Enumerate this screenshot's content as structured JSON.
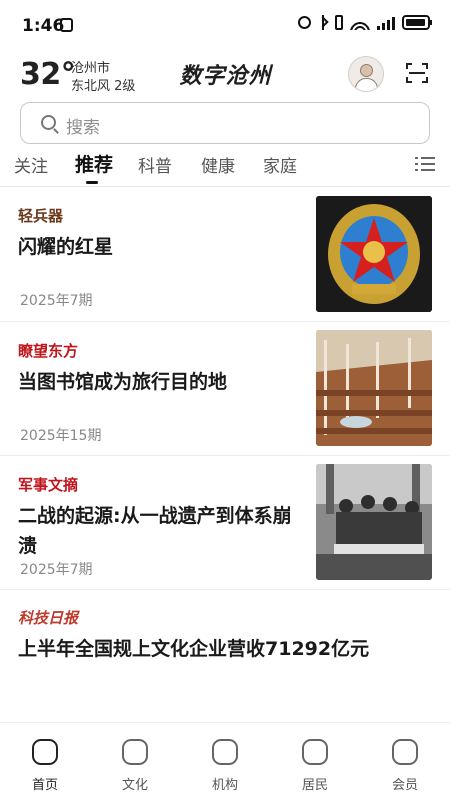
{
  "status_bar": {
    "time": "1:46"
  },
  "header": {
    "temperature": "32°",
    "city": "沧州市",
    "wind": "东北风  2级",
    "brand": "数字沧州"
  },
  "search": {
    "placeholder": "搜索"
  },
  "tabs": [
    {
      "label": "关注"
    },
    {
      "label": "推荐"
    },
    {
      "label": "科普"
    },
    {
      "label": "健康"
    },
    {
      "label": "家庭"
    }
  ],
  "articles": [
    {
      "source": "轻兵器",
      "source_color": "#6b3a1c",
      "title": "闪耀的红星",
      "issue": "2025年7期"
    },
    {
      "source": "瞭望东方",
      "source_color": "#c0151b",
      "title": "当图书馆成为旅行目的地",
      "issue": "2025年15期"
    },
    {
      "source": "军事文摘",
      "source_color": "#c0151b",
      "title": "二战的起源:从一战遗产到体系崩溃",
      "issue": "2025年7期"
    },
    {
      "source": "科技日报",
      "source_color": "#c0392b",
      "title": "上半年全国规上文化企业营收71292亿元",
      "issue": ""
    }
  ],
  "bottom_nav": [
    {
      "label": "首页",
      "icon": "home-icon"
    },
    {
      "label": "文化",
      "icon": "culture-icon"
    },
    {
      "label": "机构",
      "icon": "institution-icon"
    },
    {
      "label": "居民",
      "icon": "resident-icon"
    },
    {
      "label": "会员",
      "icon": "member-icon"
    }
  ]
}
